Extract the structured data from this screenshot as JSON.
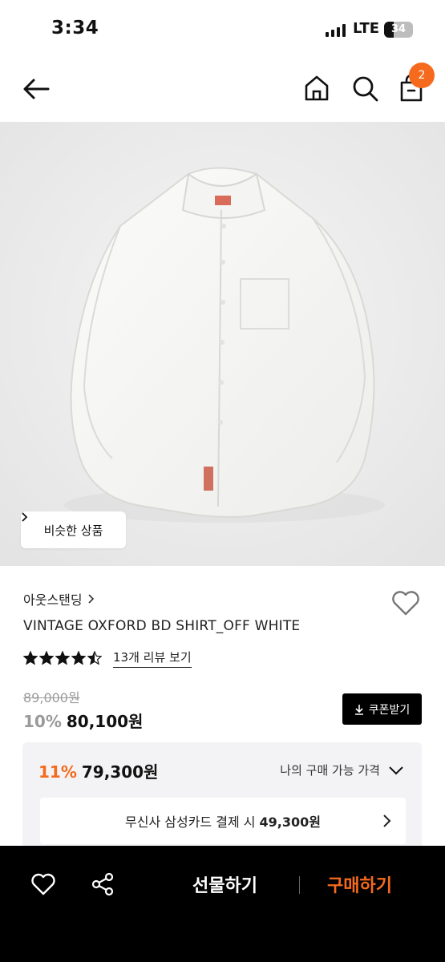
{
  "status_bar": {
    "time": "3:34",
    "network": "LTE",
    "battery": "34",
    "battery_fraction": 0.34
  },
  "nav": {
    "cart_count": "2"
  },
  "hero": {
    "similar_button": "비슷한 상품"
  },
  "product": {
    "brand": "아웃스탠딩",
    "name": "VINTAGE OXFORD BD SHIRT_OFF WHITE",
    "rating": 4.5,
    "review_link": "13개 리뷰 보기",
    "original_price": "89,000원",
    "discount": "10%",
    "price": "80,100원",
    "coupon_button": "쿠폰받기"
  },
  "promo": {
    "discount": "11%",
    "price": "79,300원",
    "my_price_label": "나의 구매 가능 가격",
    "card_text": "무신사 삼성카드 결제 시",
    "card_price": "49,300원"
  },
  "bottom_bar": {
    "gift_label": "선물하기",
    "buy_label": "구매하기"
  },
  "colors": {
    "accent": "#f56a1c",
    "bar_bg": "#000000",
    "promo_bg": "#f3f3f5"
  }
}
